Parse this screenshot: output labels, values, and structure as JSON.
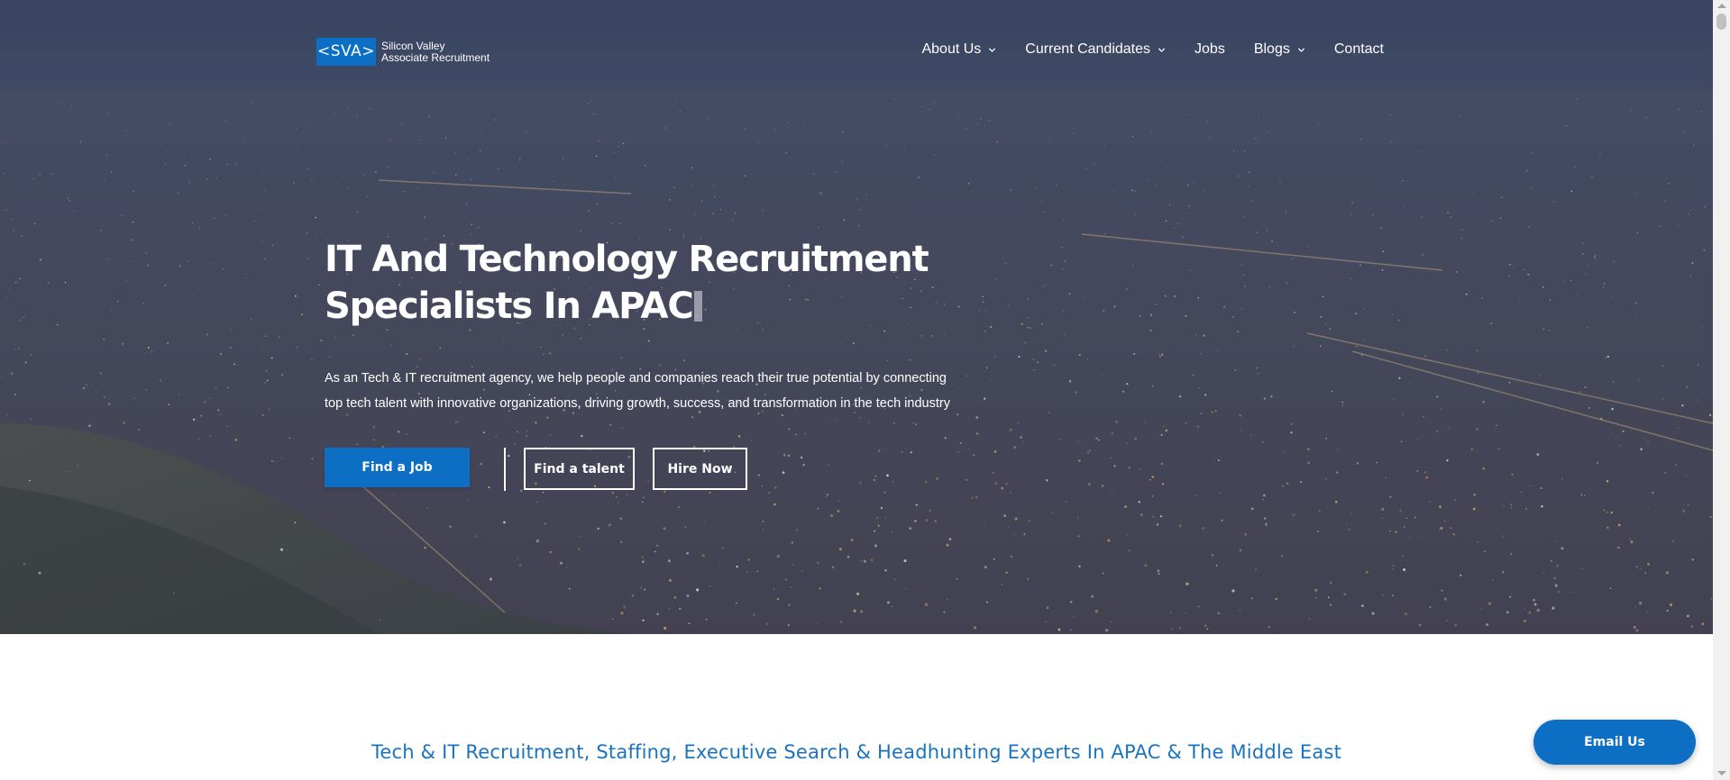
{
  "brand": {
    "logo_mark": "<SVA>",
    "logo_line1": "Silicon Valley",
    "logo_line2": "Associate Recruitment",
    "accent_color": "#0c6fc4",
    "heading_color": "#1a73bf"
  },
  "nav": {
    "items": [
      {
        "label": "About Us",
        "has_dropdown": true,
        "icon": "chevron-down-icon"
      },
      {
        "label": "Current Candidates",
        "has_dropdown": true,
        "icon": "chevron-down-icon"
      },
      {
        "label": "Jobs",
        "has_dropdown": false
      },
      {
        "label": "Blogs",
        "has_dropdown": true,
        "icon": "chevron-down-icon"
      },
      {
        "label": "Contact",
        "has_dropdown": false
      }
    ]
  },
  "hero": {
    "title_line1": "IT And Technology Recruitment",
    "title_line2": "Specialists In APAC",
    "description_line1": "As an Tech & IT recruitment agency, we help people and companies reach their true potential by connecting",
    "description_line2": "top tech talent with innovative organizations, driving growth, success, and transformation in the tech industry",
    "buttons": {
      "find_job": "Find a Job",
      "find_talent": "Find a talent",
      "hire_now": "Hire Now"
    },
    "background": "night city lights aerial view"
  },
  "section": {
    "heading": "Tech & IT Recruitment, Staffing, Executive Search & Headhunting Experts In APAC & The Middle East"
  },
  "floating": {
    "email_label": "Email Us"
  }
}
